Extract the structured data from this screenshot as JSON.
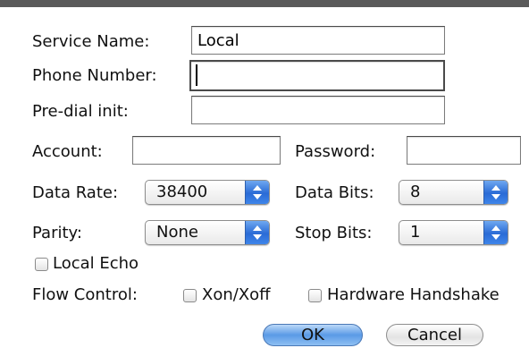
{
  "form": {
    "service_name": {
      "label": "Service Name:",
      "value": "Local"
    },
    "phone_number": {
      "label": "Phone Number:",
      "value": ""
    },
    "pre_dial_init": {
      "label": "Pre-dial init:",
      "value": ""
    },
    "account": {
      "label": "Account:",
      "value": ""
    },
    "password": {
      "label": "Password:",
      "value": ""
    },
    "data_rate": {
      "label": "Data Rate:",
      "selected": "38400"
    },
    "data_bits": {
      "label": "Data Bits:",
      "selected": "8"
    },
    "parity": {
      "label": "Parity:",
      "selected": "None"
    },
    "stop_bits": {
      "label": "Stop Bits:",
      "selected": "1"
    },
    "local_echo": {
      "label": "Local Echo",
      "checked": false
    },
    "flow_control": {
      "label": "Flow Control:",
      "xon_xoff": {
        "label": "Xon/Xoff",
        "checked": false
      },
      "hardware_handshake": {
        "label": "Hardware Handshake",
        "checked": false
      }
    }
  },
  "buttons": {
    "ok": "OK",
    "cancel": "Cancel"
  },
  "colors": {
    "accent": "#3f86ea",
    "default_button": "#5a9ae6"
  }
}
